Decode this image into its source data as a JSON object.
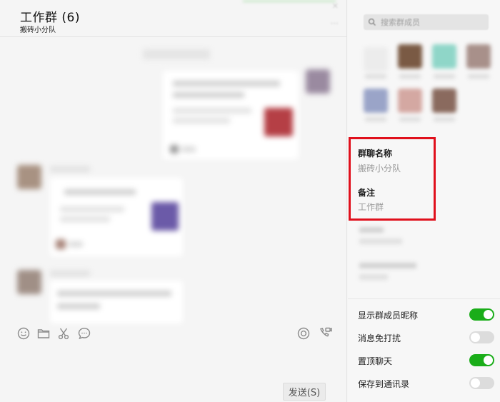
{
  "chat": {
    "title": "工作群 (6)",
    "subtitle": "搬砖小分队",
    "more_icon": "ellipsis-icon",
    "send_label": "发送(S)",
    "toolbar_icons": [
      "emoji-icon",
      "folder-icon",
      "scissors-icon",
      "chat-bubble-icon",
      "live-icon",
      "video-call-icon"
    ]
  },
  "side": {
    "search_placeholder": "搜索群成员",
    "search_icon": "search-icon",
    "info": [
      {
        "label": "群聊名称",
        "value": "搬砖小分队"
      },
      {
        "label": "备注",
        "value": "工作群"
      }
    ],
    "settings": [
      {
        "label": "显示群成员昵称",
        "on": true
      },
      {
        "label": "消息免打扰",
        "on": false
      },
      {
        "label": "置顶聊天",
        "on": true
      },
      {
        "label": "保存到通讯录",
        "on": false
      }
    ]
  },
  "colors": {
    "toggle_on": "#1aad19",
    "toggle_off": "#dcdcdc",
    "highlight_border": "#e0101c"
  }
}
